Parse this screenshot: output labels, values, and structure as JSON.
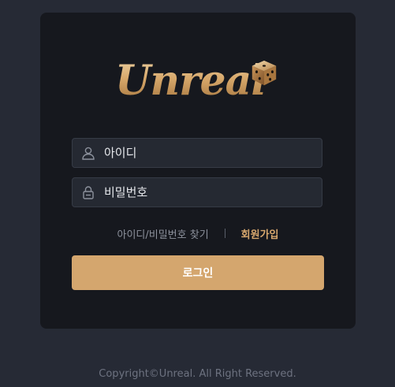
{
  "brand": {
    "logo_text": "Unreal"
  },
  "login_form": {
    "id_placeholder": "아이디",
    "password_placeholder": "비밀번호",
    "find_account_link": "아이디/비밀번호 찾기",
    "signup_link": "회원가입",
    "login_button": "로그인"
  },
  "footer": {
    "copyright": "Copyright©Unreal. All Right Reserved."
  },
  "colors": {
    "page_bg": "#262a35",
    "card_bg": "#16181e",
    "input_bg": "#252932",
    "accent": "#d4a66e"
  },
  "icons": {
    "id_field": "user-icon",
    "password_field": "lock-icon",
    "logo": "dice-icon"
  }
}
